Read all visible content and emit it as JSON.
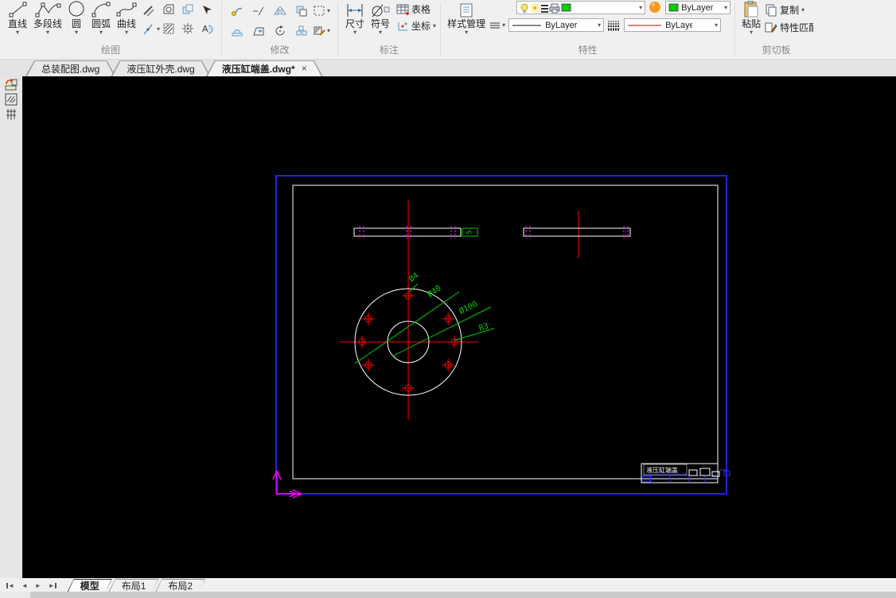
{
  "ribbon": {
    "draw": {
      "label": "绘图",
      "line": "直线",
      "polyline": "多段线",
      "circle": "圆",
      "arc": "圆弧",
      "curve": "曲线"
    },
    "modify": {
      "label": "修改"
    },
    "annotate": {
      "label": "标注",
      "dimension": "尺寸",
      "symbol": "符号",
      "table": "表格",
      "coordinate": "坐标"
    },
    "properties": {
      "label": "特性",
      "style_manager": "样式管理",
      "layer_color_value": "ByLayer",
      "linetype_value": "ByLayer",
      "linetype2_value": "ByLayer"
    },
    "clipboard": {
      "label": "剪切板",
      "paste": "粘贴",
      "copy": "复制",
      "match_properties": "特性匹配"
    }
  },
  "doc_tabs": {
    "tab1": "总装配图.dwg",
    "tab2": "液压缸外壳.dwg",
    "tab3": "液压缸端盖.dwg*"
  },
  "drawing": {
    "dims": {
      "hole_dia": "Ø4",
      "bore_dia": "Ø40",
      "bolt_circle_dia": "Ø100",
      "fillet_radius": "R3",
      "thickness": "5"
    },
    "title_block_title": "液压缸端盖",
    "colors": {
      "frame_blue": "#2222e0",
      "geometry_white": "#ffffff",
      "centerline_red": "#ff0000",
      "hidden_magenta": "#ff00ff",
      "dimension_green": "#00cc00"
    }
  },
  "nav_tabs": {
    "model": "模型",
    "layout1": "布局1",
    "layout2": "布局2"
  }
}
